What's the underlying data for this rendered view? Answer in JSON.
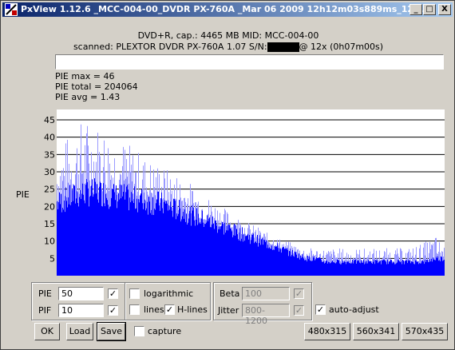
{
  "window": {
    "title": "PxView 1.12.6  _MCC-004-00_DVDR  PX-760A  _Mar 06 2009 12h12m03s889ms_12...",
    "min_glyph": "_",
    "max_glyph": "□",
    "close_glyph": "X"
  },
  "disc": {
    "line1": "DVD+R, cap.: 4465 MB MID: MCC-004-00",
    "line2_prefix": "scanned: PLEXTOR DVDR PX-760A 1.07 S/N:",
    "line2_suffix": "@ 12x (0h07m00s)"
  },
  "stats": {
    "pie_max": "PIE max = 46",
    "pie_total": "PIE total = 204064",
    "pie_avg": "PIE avg = 1.43"
  },
  "chart_data": {
    "type": "area",
    "ylabel": "PIE",
    "yticks": [
      5,
      10,
      15,
      20,
      25,
      30,
      35,
      40,
      45
    ],
    "ylim": [
      0,
      48
    ],
    "grid": true,
    "color": "#0000ff",
    "series": [
      {
        "avg_profile": [
          21,
          22,
          23,
          24,
          24,
          24,
          23,
          23,
          22,
          22,
          21,
          21,
          20,
          19,
          18,
          17,
          16,
          15,
          14,
          13,
          12,
          11,
          10,
          9,
          8,
          7,
          6,
          5,
          5,
          4,
          4,
          4,
          4,
          4,
          4,
          4,
          4,
          4,
          4,
          4,
          4,
          5,
          5
        ],
        "peak_profile": [
          38,
          40,
          44,
          46,
          45,
          44,
          42,
          40,
          38,
          36,
          34,
          33,
          31,
          30,
          28,
          26,
          24,
          22,
          20,
          18,
          17,
          15,
          14,
          12,
          11,
          10,
          9,
          8,
          8,
          8,
          8,
          8,
          8,
          8,
          8,
          8,
          8,
          8,
          8,
          9,
          10,
          12,
          9
        ]
      }
    ]
  },
  "controls": {
    "pie_label": "PIE",
    "pie_value": "50",
    "pif_label": "PIF",
    "pif_value": "10",
    "pie_check": "✓",
    "pif_check": "✓",
    "logarithmic_label": "logarithmic",
    "lines_label": "lines",
    "hlines_label": "H-lines",
    "hlines_check": "✓",
    "beta_label": "Beta",
    "beta_value": "100",
    "beta_check": "✓",
    "jitter_label": "Jitter",
    "jitter_value": "800-1200",
    "jitter_check": "✓",
    "auto_adjust_label": "auto-adjust",
    "auto_adjust_check": "✓",
    "capture_label": "capture"
  },
  "buttons": {
    "ok": "OK",
    "load": "Load",
    "save": "Save",
    "size1": "480x315",
    "size2": "560x341",
    "size3": "570x435"
  }
}
